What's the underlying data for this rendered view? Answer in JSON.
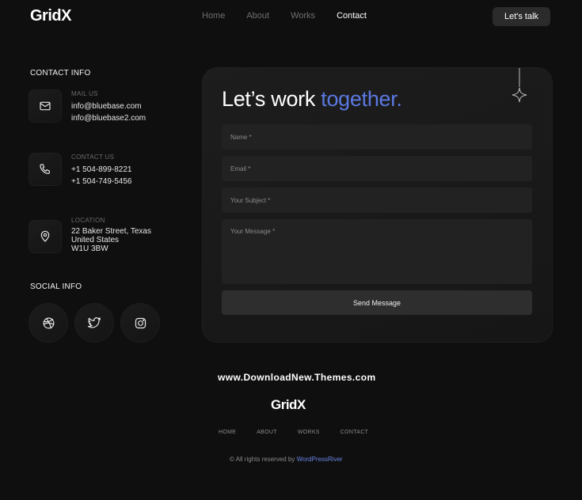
{
  "header": {
    "logo": "GridX",
    "nav": [
      "Home",
      "About",
      "Works",
      "Contact"
    ],
    "active_nav": "Contact",
    "cta": "Let's talk"
  },
  "contact_info": {
    "title": "CONTACT INFO",
    "mail": {
      "label": "MAIL US",
      "lines": [
        "info@bluebase.com",
        "info@bluebase2.com"
      ],
      "icon": "mail-icon"
    },
    "phone": {
      "label": "CONTACT US",
      "lines": [
        "+1 504-899-8221",
        "+1 504-749-5456"
      ],
      "icon": "phone-icon"
    },
    "location": {
      "label": "LOCATION",
      "lines": [
        "22 Baker Street, Texas",
        "United States",
        "W1U 3BW"
      ],
      "icon": "location-pin-icon"
    }
  },
  "social_info": {
    "title": "SOCIAL INFO",
    "icons": [
      "dribbble-icon",
      "twitter-icon",
      "instagram-icon"
    ]
  },
  "form": {
    "heading": "Let’s work",
    "heading_accent": "together.",
    "name_placeholder": "Name *",
    "email_placeholder": "Email *",
    "subject_placeholder": "Your Subject *",
    "message_placeholder": "Your Message *",
    "submit": "Send Message"
  },
  "watermark": "www.DownloadNew.Themes.com",
  "footer": {
    "logo": "GridX",
    "nav": [
      "HOME",
      "ABOUT",
      "WORKS",
      "CONTACT"
    ],
    "copyright_prefix": "© All rights reserved by",
    "copyright_brand": "WordPressRiver"
  },
  "colors": {
    "background": "#0f0f0f",
    "accent": "#5b78e0",
    "card": "#1b1b1b"
  }
}
